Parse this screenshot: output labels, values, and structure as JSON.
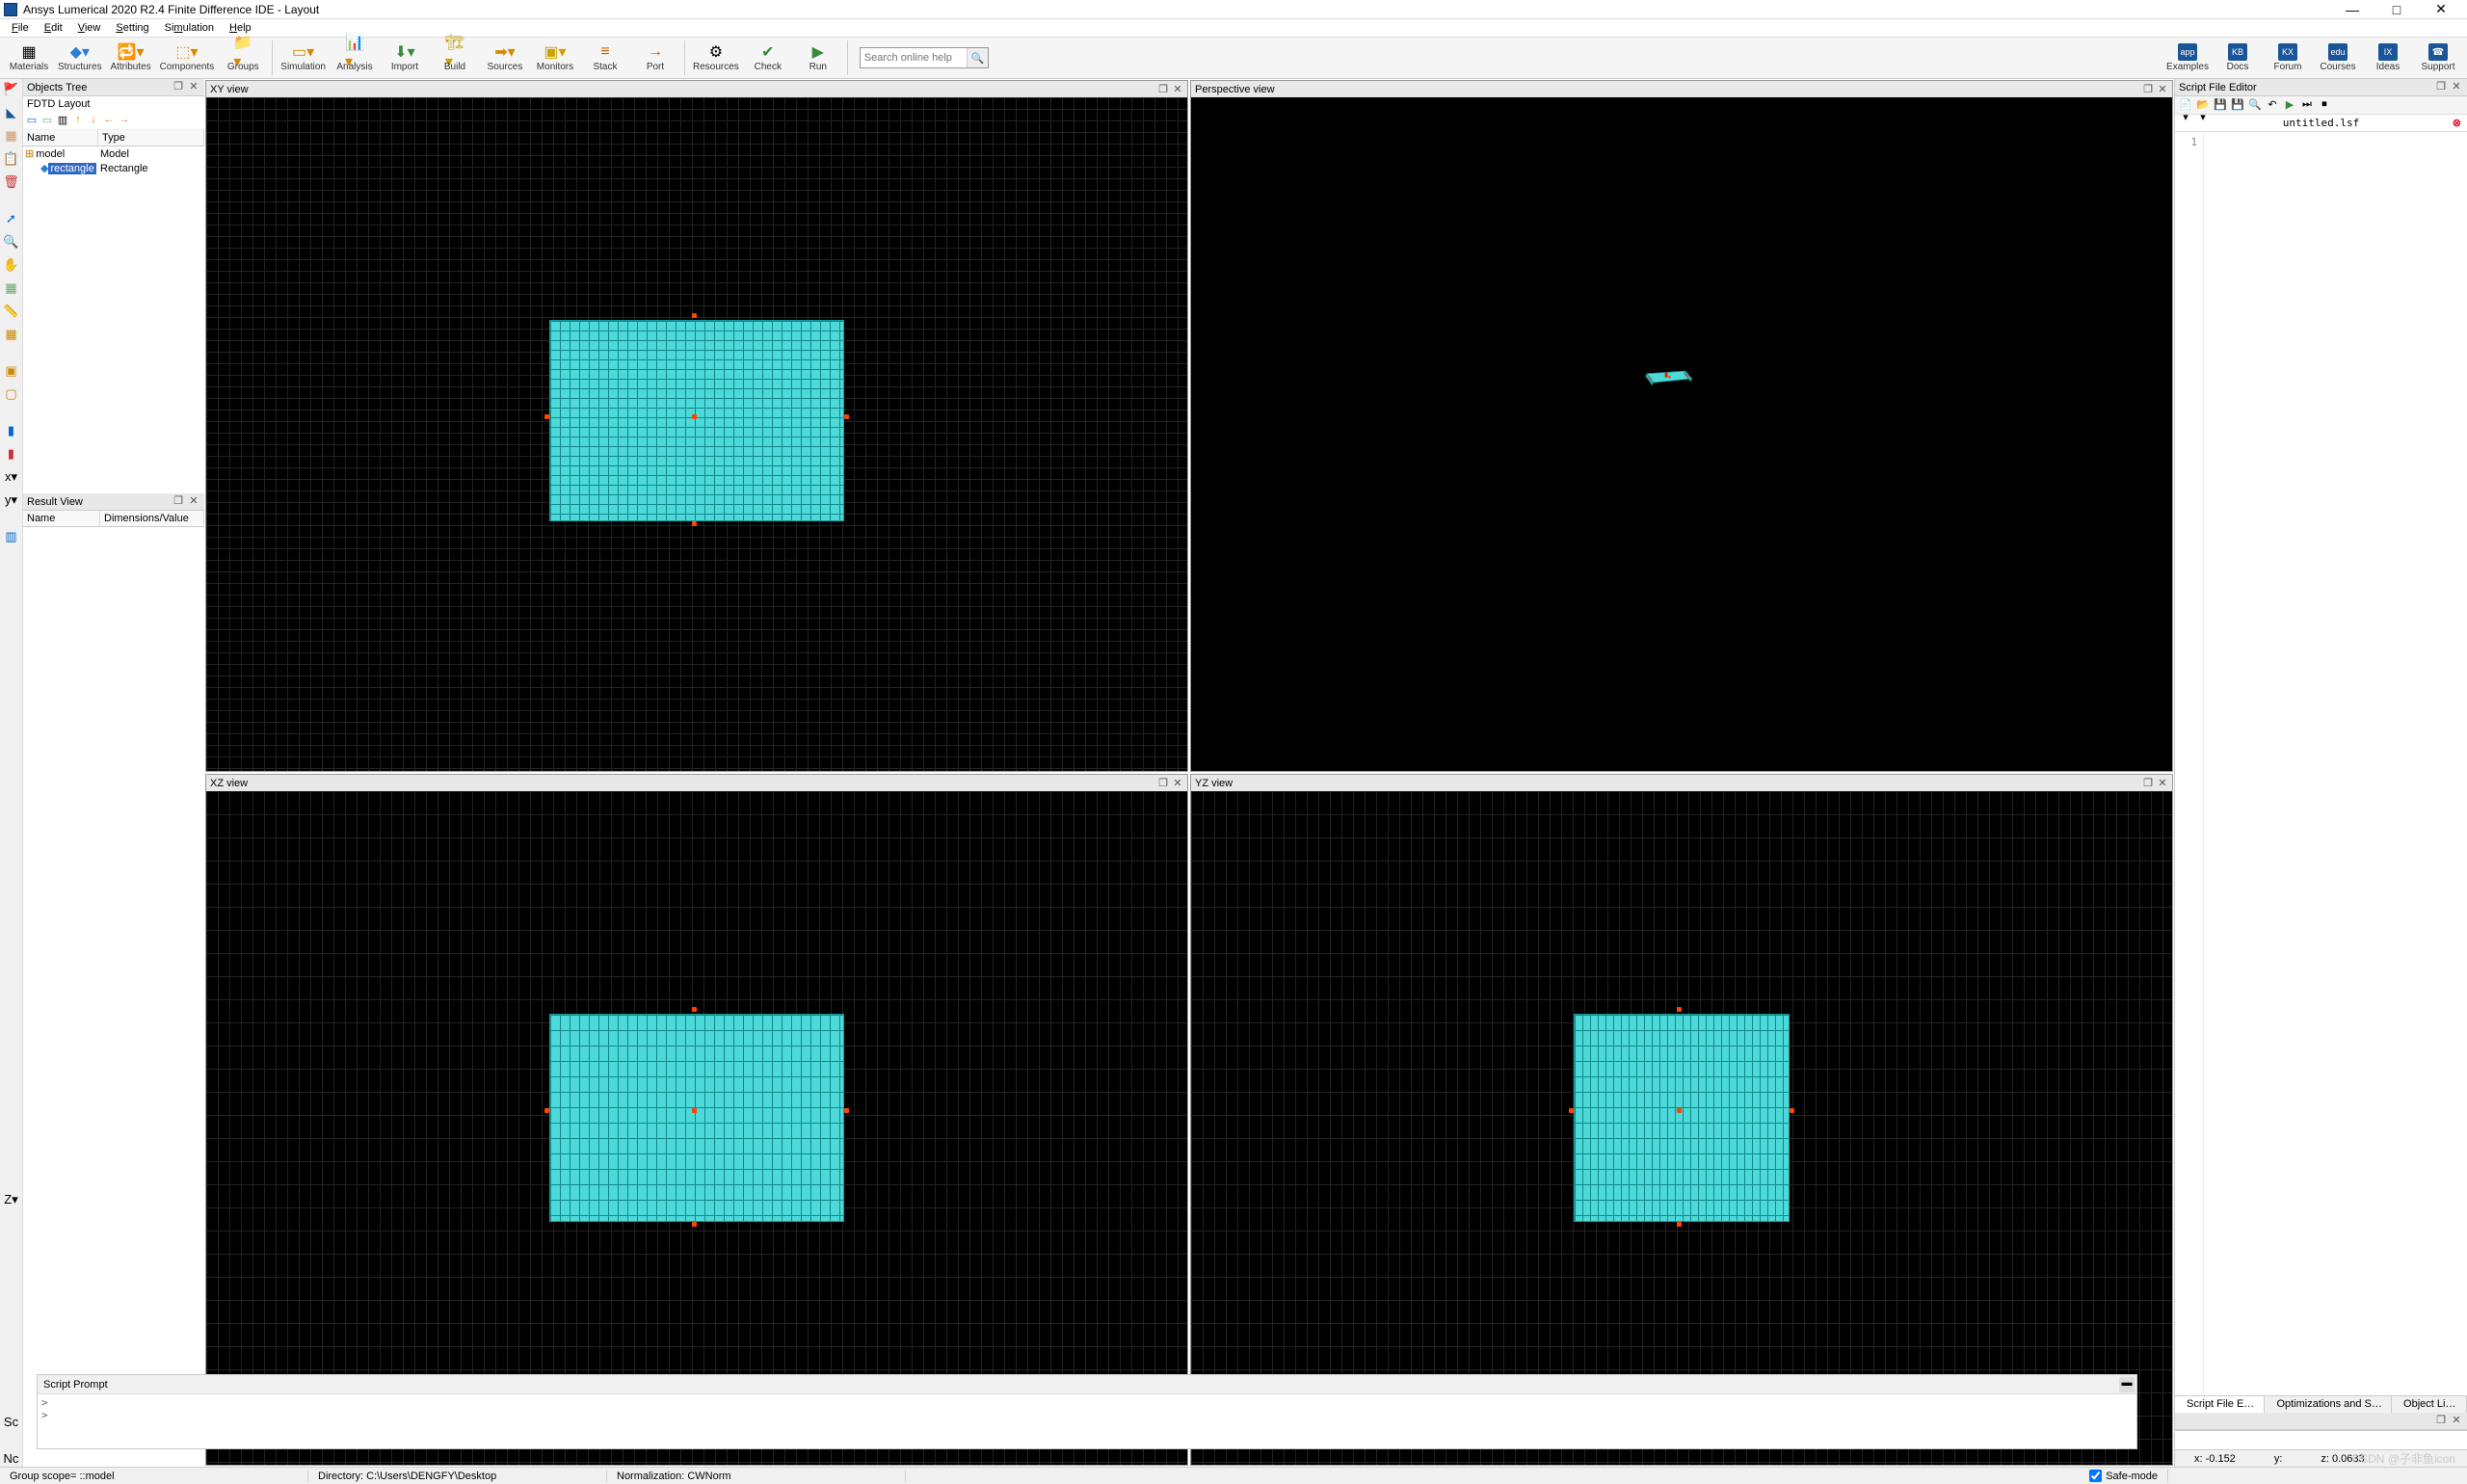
{
  "title": "Ansys Lumerical 2020 R2.4 Finite Difference IDE - Layout",
  "menu": {
    "file": "File",
    "edit": "Edit",
    "view": "View",
    "setting": "Setting",
    "simulation": "Simulation",
    "help": "Help"
  },
  "toolbar": {
    "materials": "Materials",
    "structures": "Structures",
    "attributes": "Attributes",
    "components": "Components",
    "groups": "Groups",
    "simulation": "Simulation",
    "analysis": "Analysis",
    "import": "Import",
    "build": "Build",
    "sources": "Sources",
    "monitors": "Monitors",
    "stack": "Stack",
    "port": "Port",
    "resources": "Resources",
    "check": "Check",
    "run": "Run",
    "examples": "Examples",
    "docs": "Docs",
    "forum": "Forum",
    "courses": "Courses",
    "ideas": "Ideas",
    "support": "Support",
    "search_placeholder": "Search online help"
  },
  "panels": {
    "objects_tree": "Objects Tree",
    "fdtd_layout": "FDTD Layout",
    "tree_cols": {
      "name": "Name",
      "type": "Type"
    },
    "tree": [
      {
        "name": "model",
        "type": "Model",
        "indent": 0,
        "expander": "+",
        "selected": false
      },
      {
        "name": "rectangle",
        "type": "Rectangle",
        "indent": 1,
        "expander": "",
        "selected": true
      }
    ],
    "result_view": "Result View",
    "result_cols": {
      "name": "Name",
      "dims": "Dimensions/Value"
    },
    "script_editor": "Script File Editor",
    "script_file": "untitled.lsf",
    "line_no": "1",
    "btabs": [
      "Script File E…",
      "Optimizations and S…",
      "Object Li…"
    ],
    "script_prompt": "Script Prompt"
  },
  "views": {
    "xy": "XY view",
    "persp": "Perspective view",
    "xz": "XZ view",
    "yz": "YZ view"
  },
  "status": {
    "scope": "Group scope= ::model",
    "dir": "Directory: C:\\Users\\DENGFY\\Desktop",
    "norm": "Normalization: CWNorm",
    "safemode": "Safe-mode",
    "x": "x: -0.152",
    "y": "y:",
    "z": "z: 0.0633"
  },
  "watermark": "CSDN @子非鱼icon"
}
